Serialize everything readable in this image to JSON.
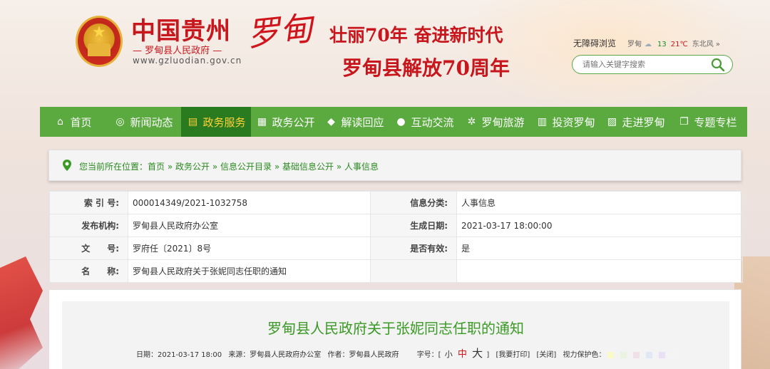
{
  "header": {
    "site_title": "中国贵州",
    "brush_title": "罗甸",
    "site_subtitle": "— 罗甸县人民政府 —",
    "site_url": "www.gzluodian.gov.cn",
    "slogan_line1": "壮丽70年 奋进新时代",
    "slogan_line2": "罗甸县解放70周年",
    "accessibility_link": "无障碍浏览",
    "weather": {
      "city": "罗甸",
      "low": "13",
      "high": "21℃",
      "wind": "东北风",
      "more": "»"
    },
    "search": {
      "placeholder": "请输入关键字搜索",
      "value": ""
    }
  },
  "nav": {
    "items": [
      {
        "label": "首页",
        "icon": "home-icon",
        "glyph": "⌂"
      },
      {
        "label": "新闻动态",
        "icon": "globe-icon",
        "glyph": "◎"
      },
      {
        "label": "政务服务",
        "icon": "id-card-icon",
        "glyph": "▤",
        "active": true
      },
      {
        "label": "政务公开",
        "icon": "document-icon",
        "glyph": "▦"
      },
      {
        "label": "解读回应",
        "icon": "people-icon",
        "glyph": "◆"
      },
      {
        "label": "互动交流",
        "icon": "chat-icon",
        "glyph": "●"
      },
      {
        "label": "罗甸旅游",
        "icon": "palm-tree-icon",
        "glyph": "✲"
      },
      {
        "label": "投资罗甸",
        "icon": "bar-chart-icon",
        "glyph": "▥"
      },
      {
        "label": "走进罗甸",
        "icon": "picture-icon",
        "glyph": "▨"
      },
      {
        "label": "专题专栏",
        "icon": "windows-icon",
        "glyph": "❐"
      }
    ]
  },
  "breadcrumb": {
    "prefix": "您当前所在位置：",
    "items": [
      "首页",
      "政务公开",
      "信息公开目录",
      "基础信息公开",
      "人事信息"
    ],
    "separator": " » "
  },
  "info": {
    "rows": [
      {
        "k1": "索 引 号:",
        "v1": "000014349/2021-1032758",
        "k2": "信息分类:",
        "v2": "人事信息"
      },
      {
        "k1": "发布机构:",
        "v1": "罗甸县人民政府办公室",
        "k2": "生成日期:",
        "v2": "2021-03-17 18:00:00"
      },
      {
        "k1": "文　　号:",
        "v1": "罗府任〔2021〕8号",
        "k2": "是否有效:",
        "v2": "是"
      },
      {
        "k1": "名　　称:",
        "v1": "罗甸县人民政府关于张妮同志任职的通知",
        "k2": "",
        "v2": ""
      }
    ]
  },
  "article": {
    "title": "罗甸县人民政府关于张妮同志任职的通知",
    "meta": {
      "date": "日期：2021-03-17 18:00",
      "source": "来源：罗甸县人民政府办公室",
      "author": "作者：罗甸县人民政府",
      "font_size_label": "字号：[",
      "size_small": "小",
      "size_medium": "中",
      "size_large": "大",
      "font_size_close": "]",
      "print": "[我要打印]",
      "close": "[关闭]",
      "eye_care": "视力保护色："
    },
    "eye_care_colors": [
      "#fafac8",
      "#e8f4e0",
      "#f0e0e8",
      "#e0e8f4",
      "#e8e0f4",
      "#f4f4f4"
    ]
  },
  "colors": {
    "brand_red": "#c8161d",
    "nav_green": "#5aaa3f",
    "nav_active": "#2a7a1f",
    "link_green": "#2a8a1f"
  }
}
